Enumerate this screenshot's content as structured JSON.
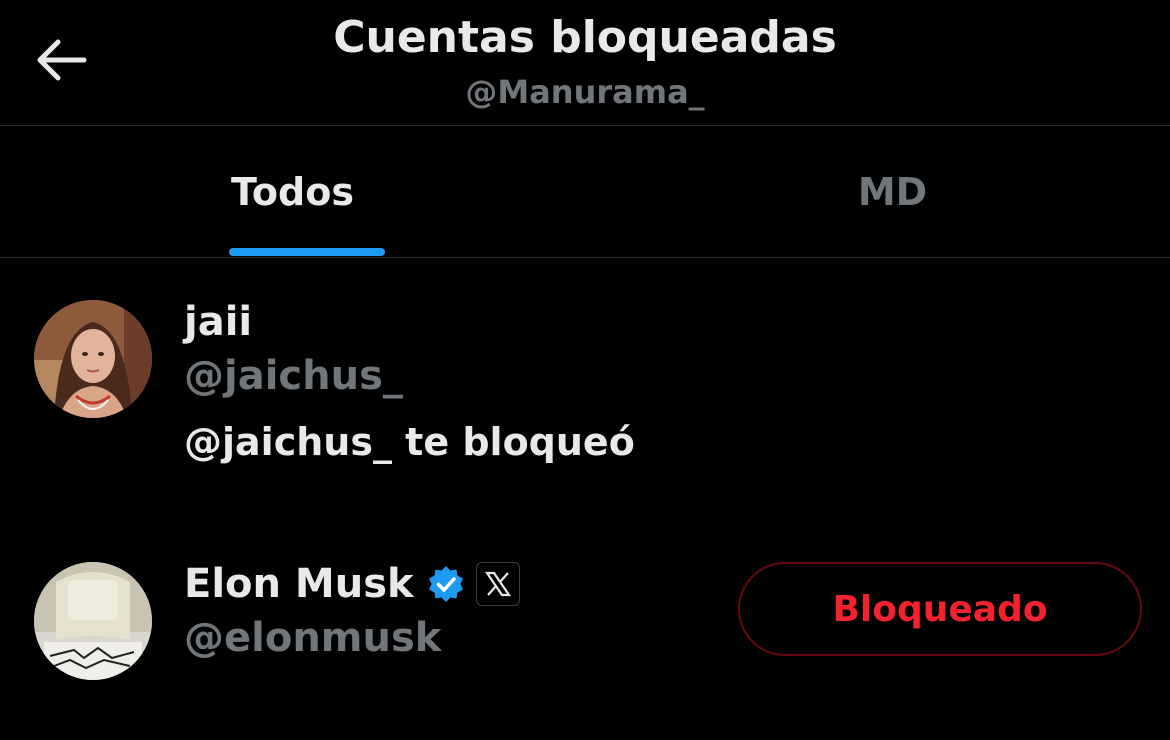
{
  "header": {
    "title": "Cuentas bloqueadas",
    "subtitle": "@Manurama_",
    "back_icon": "arrow-left-icon"
  },
  "tabs": [
    {
      "label": "Todos",
      "selected": true
    },
    {
      "label": "MD",
      "selected": false
    }
  ],
  "accounts": [
    {
      "name": "jaii",
      "handle": "@jaichus_",
      "note": "@jaichus_ te bloqueó"
    },
    {
      "name": "Elon Musk",
      "handle": "@elonmusk",
      "verified": true,
      "affiliate_badge_icon": "x-logo-icon",
      "button_label": "Bloqueado"
    }
  ],
  "colors": {
    "background": "#000000",
    "primary_text": "#e7e9ea",
    "secondary_text": "#71767b",
    "accent": "#1d9bf0",
    "blocked_red": "#f4212e",
    "blocked_border": "#67070f",
    "divider": "#2f3336"
  }
}
